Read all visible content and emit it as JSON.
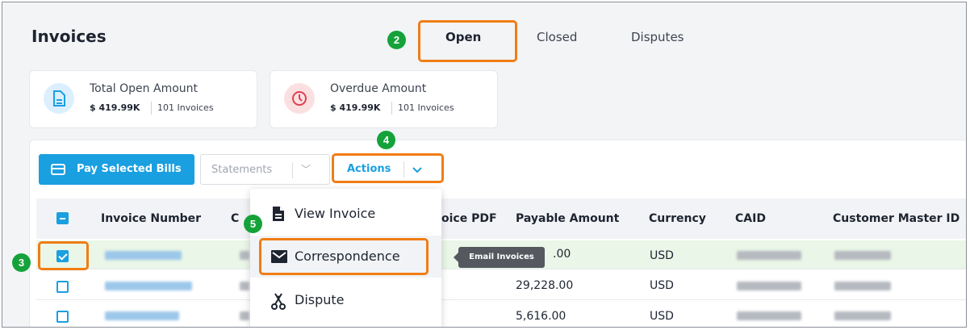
{
  "page": {
    "title": "Invoices"
  },
  "tabs": [
    {
      "label": "Open",
      "active": true
    },
    {
      "label": "Closed",
      "active": false
    },
    {
      "label": "Disputes",
      "active": false
    }
  ],
  "steps": [
    "2",
    "3",
    "4",
    "5"
  ],
  "summary": {
    "open": {
      "label": "Total Open Amount",
      "amount": "$ 419.99K",
      "count": "101 Invoices",
      "icon": "document-icon",
      "color": "#1a9fe0"
    },
    "overdue": {
      "label": "Overdue Amount",
      "amount": "$ 419.99K",
      "count": "101 Invoices",
      "icon": "clock-icon",
      "color": "#e0404e"
    }
  },
  "toolbar": {
    "pay_label": "Pay Selected Bills",
    "statements_label": "Statements",
    "actions_label": "Actions"
  },
  "table": {
    "columns": [
      "Invoice Number",
      "C",
      "oice PDF",
      "Payable Amount",
      "Currency",
      "CAID",
      "Customer Master ID"
    ],
    "rows": [
      {
        "selected": true,
        "payable_amount": ".00",
        "currency": "USD"
      },
      {
        "selected": false,
        "payable_amount": "29,228.00",
        "currency": "USD"
      },
      {
        "selected": false,
        "payable_amount": "5,616.00",
        "currency": "USD"
      }
    ]
  },
  "actions_menu": [
    {
      "label": "View Invoice",
      "icon": "document-icon"
    },
    {
      "label": "Correspondence",
      "icon": "envelope-icon"
    },
    {
      "label": "Dispute",
      "icon": "dispute-icon"
    }
  ],
  "tooltip": {
    "text": "Email Invoices"
  },
  "colors": {
    "accent": "#1a9fe0",
    "highlight": "#f07d15",
    "step": "#15a23a",
    "selected_row": "#eaf6e7"
  }
}
